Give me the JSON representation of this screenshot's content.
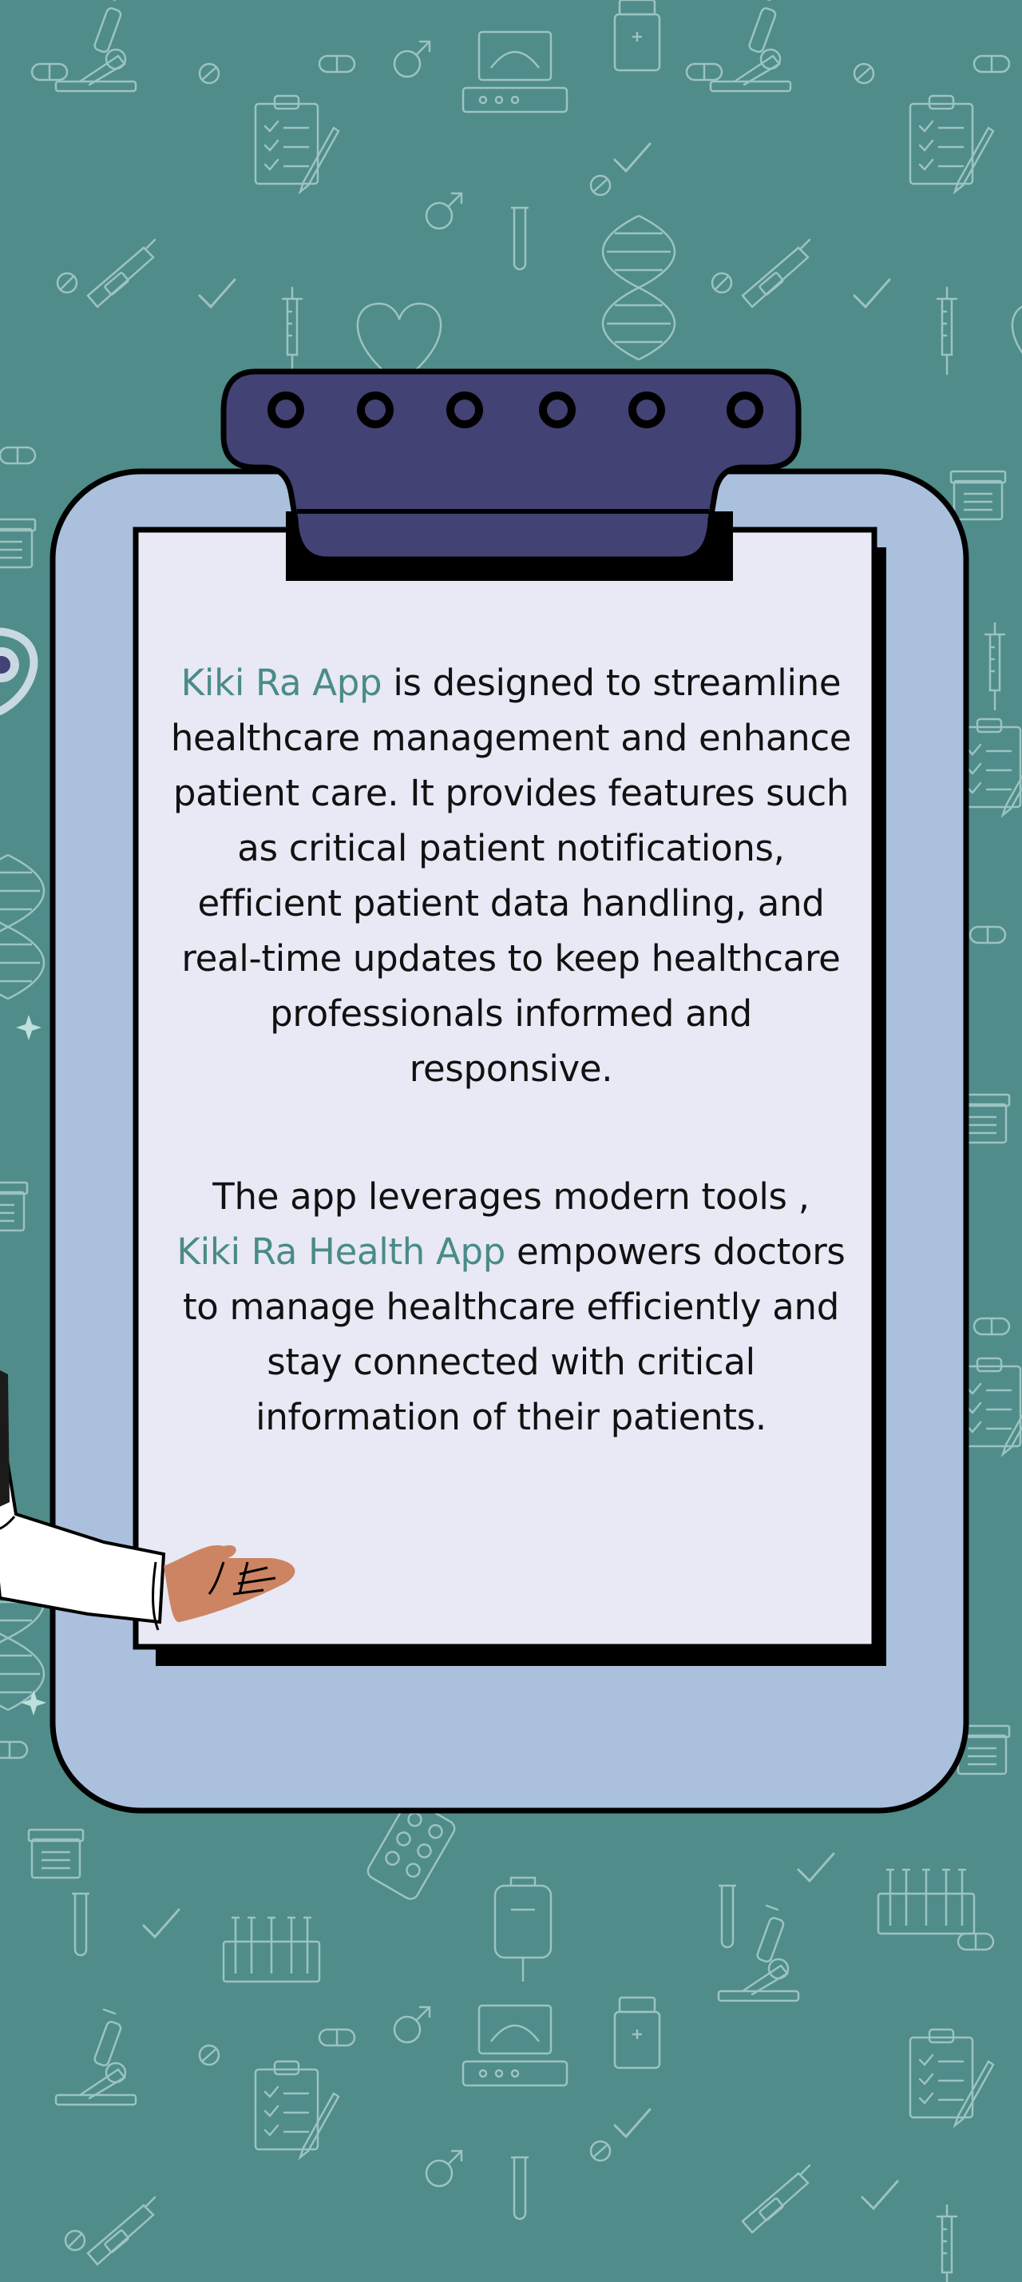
{
  "colors": {
    "background": "#4f8c8a",
    "pattern_line": "#9cc3c0",
    "board": "#aac0dc",
    "clip": "#434274",
    "paper": "#e8e9f5",
    "outline": "#000000",
    "accent_text": "#4a8b89",
    "body_text": "#111111",
    "hand_skin": "#cd8463",
    "sleeve": "#ffffff"
  },
  "icons": [
    "microscope-icon",
    "clipboard-icon",
    "pill-icon",
    "thermometer-icon",
    "syringe-icon",
    "dna-icon",
    "checkmark-icon",
    "gender-icon",
    "test-tube-icon",
    "iv-bag-icon",
    "pill-blister-icon",
    "medicine-bottle-icon",
    "heart-icon",
    "stethoscope-icon"
  ],
  "paragraph1": {
    "highlight": "Kiki Ra App",
    "text": " is designed to streamline healthcare management and enhance patient care. It provides features such as critical patient notifications, efficient patient data handling, and real-time updates to keep healthcare professionals informed and responsive."
  },
  "paragraph2": {
    "lead": "The app leverages modern tools ,",
    "highlight": "Kiki Ra Health App",
    "text": " empowers doctors to manage healthcare efficiently and stay connected with critical information of their patients."
  }
}
